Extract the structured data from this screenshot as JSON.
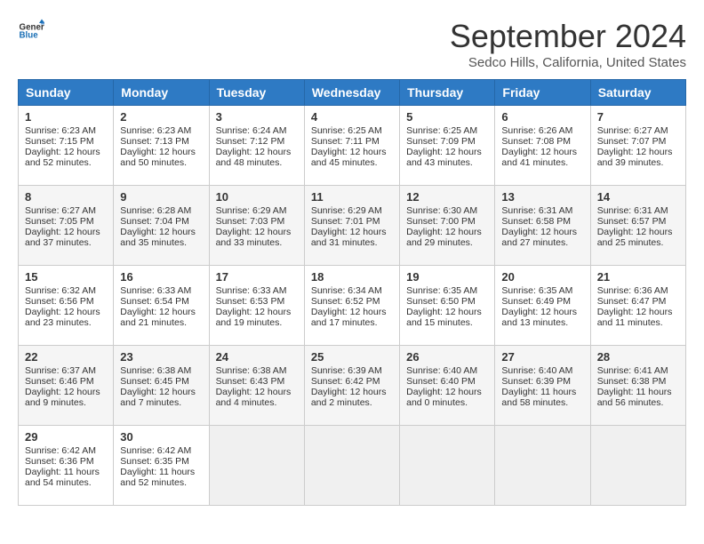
{
  "header": {
    "logo_general": "General",
    "logo_blue": "Blue",
    "month_title": "September 2024",
    "location": "Sedco Hills, California, United States"
  },
  "weekdays": [
    "Sunday",
    "Monday",
    "Tuesday",
    "Wednesday",
    "Thursday",
    "Friday",
    "Saturday"
  ],
  "weeks": [
    [
      {
        "day": "1",
        "sunrise": "6:23 AM",
        "sunset": "7:15 PM",
        "daylight": "12 hours and 52 minutes."
      },
      {
        "day": "2",
        "sunrise": "6:23 AM",
        "sunset": "7:13 PM",
        "daylight": "12 hours and 50 minutes."
      },
      {
        "day": "3",
        "sunrise": "6:24 AM",
        "sunset": "7:12 PM",
        "daylight": "12 hours and 48 minutes."
      },
      {
        "day": "4",
        "sunrise": "6:25 AM",
        "sunset": "7:11 PM",
        "daylight": "12 hours and 45 minutes."
      },
      {
        "day": "5",
        "sunrise": "6:25 AM",
        "sunset": "7:09 PM",
        "daylight": "12 hours and 43 minutes."
      },
      {
        "day": "6",
        "sunrise": "6:26 AM",
        "sunset": "7:08 PM",
        "daylight": "12 hours and 41 minutes."
      },
      {
        "day": "7",
        "sunrise": "6:27 AM",
        "sunset": "7:07 PM",
        "daylight": "12 hours and 39 minutes."
      }
    ],
    [
      {
        "day": "8",
        "sunrise": "6:27 AM",
        "sunset": "7:05 PM",
        "daylight": "12 hours and 37 minutes."
      },
      {
        "day": "9",
        "sunrise": "6:28 AM",
        "sunset": "7:04 PM",
        "daylight": "12 hours and 35 minutes."
      },
      {
        "day": "10",
        "sunrise": "6:29 AM",
        "sunset": "7:03 PM",
        "daylight": "12 hours and 33 minutes."
      },
      {
        "day": "11",
        "sunrise": "6:29 AM",
        "sunset": "7:01 PM",
        "daylight": "12 hours and 31 minutes."
      },
      {
        "day": "12",
        "sunrise": "6:30 AM",
        "sunset": "7:00 PM",
        "daylight": "12 hours and 29 minutes."
      },
      {
        "day": "13",
        "sunrise": "6:31 AM",
        "sunset": "6:58 PM",
        "daylight": "12 hours and 27 minutes."
      },
      {
        "day": "14",
        "sunrise": "6:31 AM",
        "sunset": "6:57 PM",
        "daylight": "12 hours and 25 minutes."
      }
    ],
    [
      {
        "day": "15",
        "sunrise": "6:32 AM",
        "sunset": "6:56 PM",
        "daylight": "12 hours and 23 minutes."
      },
      {
        "day": "16",
        "sunrise": "6:33 AM",
        "sunset": "6:54 PM",
        "daylight": "12 hours and 21 minutes."
      },
      {
        "day": "17",
        "sunrise": "6:33 AM",
        "sunset": "6:53 PM",
        "daylight": "12 hours and 19 minutes."
      },
      {
        "day": "18",
        "sunrise": "6:34 AM",
        "sunset": "6:52 PM",
        "daylight": "12 hours and 17 minutes."
      },
      {
        "day": "19",
        "sunrise": "6:35 AM",
        "sunset": "6:50 PM",
        "daylight": "12 hours and 15 minutes."
      },
      {
        "day": "20",
        "sunrise": "6:35 AM",
        "sunset": "6:49 PM",
        "daylight": "12 hours and 13 minutes."
      },
      {
        "day": "21",
        "sunrise": "6:36 AM",
        "sunset": "6:47 PM",
        "daylight": "12 hours and 11 minutes."
      }
    ],
    [
      {
        "day": "22",
        "sunrise": "6:37 AM",
        "sunset": "6:46 PM",
        "daylight": "12 hours and 9 minutes."
      },
      {
        "day": "23",
        "sunrise": "6:38 AM",
        "sunset": "6:45 PM",
        "daylight": "12 hours and 7 minutes."
      },
      {
        "day": "24",
        "sunrise": "6:38 AM",
        "sunset": "6:43 PM",
        "daylight": "12 hours and 4 minutes."
      },
      {
        "day": "25",
        "sunrise": "6:39 AM",
        "sunset": "6:42 PM",
        "daylight": "12 hours and 2 minutes."
      },
      {
        "day": "26",
        "sunrise": "6:40 AM",
        "sunset": "6:40 PM",
        "daylight": "12 hours and 0 minutes."
      },
      {
        "day": "27",
        "sunrise": "6:40 AM",
        "sunset": "6:39 PM",
        "daylight": "11 hours and 58 minutes."
      },
      {
        "day": "28",
        "sunrise": "6:41 AM",
        "sunset": "6:38 PM",
        "daylight": "11 hours and 56 minutes."
      }
    ],
    [
      {
        "day": "29",
        "sunrise": "6:42 AM",
        "sunset": "6:36 PM",
        "daylight": "11 hours and 54 minutes."
      },
      {
        "day": "30",
        "sunrise": "6:42 AM",
        "sunset": "6:35 PM",
        "daylight": "11 hours and 52 minutes."
      },
      null,
      null,
      null,
      null,
      null
    ]
  ]
}
